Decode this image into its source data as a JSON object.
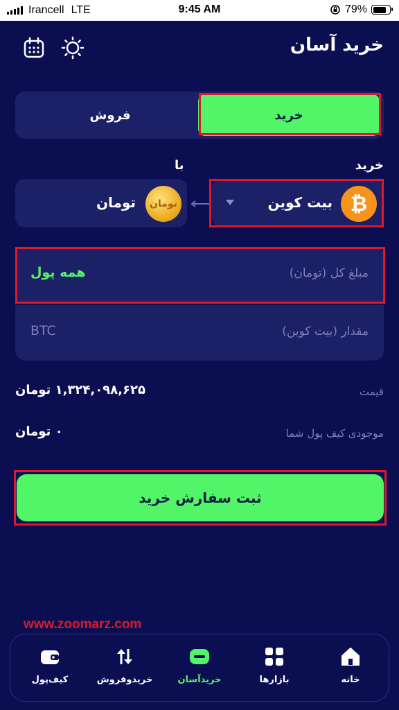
{
  "status_bar": {
    "carrier": "Irancell",
    "network": "LTE",
    "time": "9:45 AM",
    "battery": "79%",
    "battery_level": 0.79
  },
  "header": {
    "title": "خرید آسان",
    "icons": [
      "calendar-icon",
      "sun-icon"
    ]
  },
  "segment": {
    "buy_label": "خرید",
    "sell_label": "فروش",
    "selected": "buy"
  },
  "pair": {
    "buy_label": "خرید",
    "with_label": "با",
    "buy_asset": "بیت کوین",
    "buy_asset_glyph": "₿",
    "quote_asset": "تومان",
    "quote_asset_glyph": "تومان"
  },
  "form": {
    "total_placeholder": "مبلغ کل (تومان)",
    "all_balance_label": "همه پول",
    "amount_placeholder": "مقدار (بیت کوین)",
    "amount_unit": "BTC"
  },
  "info": {
    "price_label": "قیمت",
    "price_value": "۱,۳۲۴,۰۹۸,۶۲۵ تومان",
    "balance_label": "موجودی کیف پول شما",
    "balance_value": "۰ تومان"
  },
  "submit_label": "ثبت سفارش خرید",
  "watermark": "www.zoomarz.com",
  "tabbar": {
    "items": [
      {
        "label": "کیف‌پول",
        "icon": "wallet-icon"
      },
      {
        "label": "خریدوفروش",
        "icon": "trade-icon"
      },
      {
        "label": "خریدآسان",
        "icon": "easy-buy-icon",
        "active": true
      },
      {
        "label": "بازارها",
        "icon": "markets-icon"
      },
      {
        "label": "خانه",
        "icon": "home-icon"
      }
    ]
  },
  "colors": {
    "background": "#0b0f52",
    "card": "#1c2066",
    "accent": "#52f567",
    "highlight": "#e0182a"
  }
}
